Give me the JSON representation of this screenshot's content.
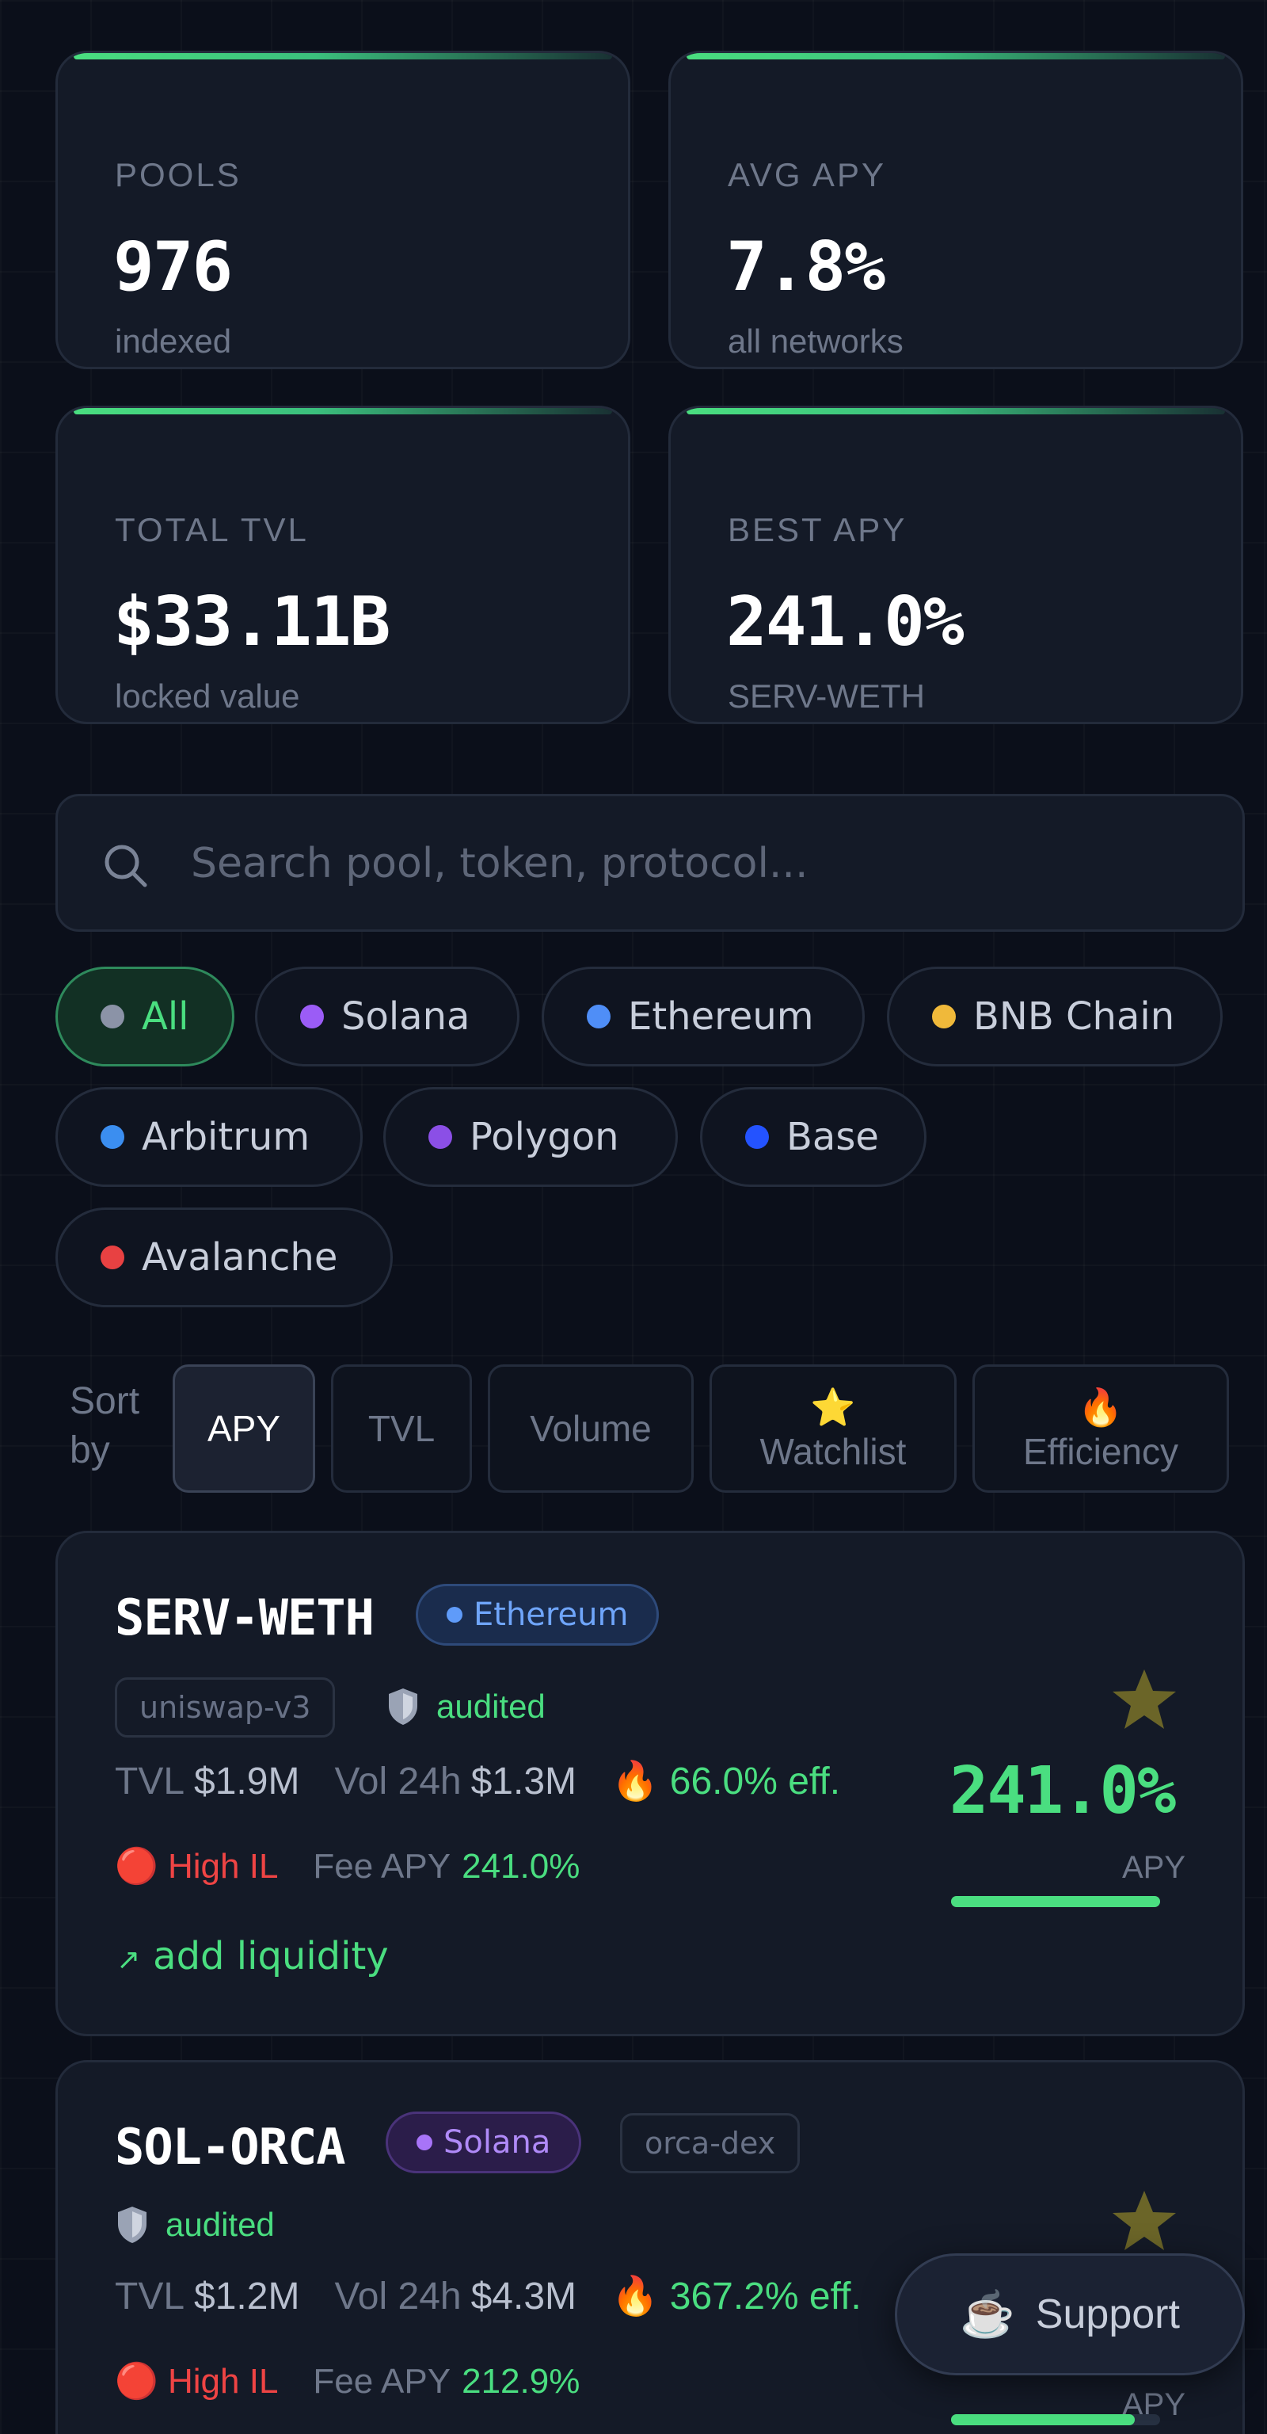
{
  "stats": [
    {
      "label": "POOLS",
      "value": "976",
      "sub": "indexed"
    },
    {
      "label": "AVG APY",
      "value": "7.8%",
      "sub": "all networks"
    },
    {
      "label": "TOTAL TVL",
      "value": "$33.11B",
      "sub": "locked value"
    },
    {
      "label": "BEST APY",
      "value": "241.0%",
      "sub": "SERV-WETH"
    }
  ],
  "search": {
    "placeholder": "Search pool, token, protocol..."
  },
  "chains": [
    {
      "label": "All",
      "color": "#8b93a7",
      "active": true
    },
    {
      "label": "Solana",
      "color": "#9b5cf6"
    },
    {
      "label": "Ethereum",
      "color": "#4f8ef7"
    },
    {
      "label": "BNB Chain",
      "color": "#f0b93a"
    },
    {
      "label": "Arbitrum",
      "color": "#3b8ef0"
    },
    {
      "label": "Polygon",
      "color": "#8b4fe6"
    },
    {
      "label": "Base",
      "color": "#2453ff"
    },
    {
      "label": "Avalanche",
      "color": "#e84142"
    }
  ],
  "sort": {
    "label": "Sort by",
    "options": [
      {
        "label": "APY",
        "active": true
      },
      {
        "label": "TVL"
      },
      {
        "label": "Volume"
      },
      {
        "label": "Watchlist",
        "emoji": "⭐"
      },
      {
        "label": "Efficiency",
        "emoji": "🔥"
      }
    ]
  },
  "pools": [
    {
      "name": "SERV-WETH",
      "chain": "Ethereum",
      "chain_color": "#5f9bf9",
      "protocol": "uniswap-v3",
      "audited": "audited",
      "tvl_label": "TVL",
      "tvl": "$1.9M",
      "vol_label": "Vol 24h",
      "vol": "$1.3M",
      "eff": "66.0% eff.",
      "il": "🔴 High IL",
      "fee_label": "Fee APY",
      "fee_apy": "241.0%",
      "add": "add liquidity",
      "apy": "241.0%",
      "apy_label": "APY",
      "apy_fill": 1.0
    },
    {
      "name": "SOL-ORCA",
      "chain": "Solana",
      "chain_color": "#a874f8",
      "protocol": "orca-dex",
      "audited": "audited",
      "tvl_label": "TVL",
      "tvl": "$1.2M",
      "vol_label": "Vol 24h",
      "vol": "$4.3M",
      "eff": "367.2% eff.",
      "il": "🔴 High IL",
      "fee_label": "Fee APY",
      "fee_apy": "212.9%",
      "apy_label": "APY",
      "apy_fill": 0.88
    }
  ],
  "support": {
    "icon": "coffee-icon",
    "label": "Support"
  }
}
